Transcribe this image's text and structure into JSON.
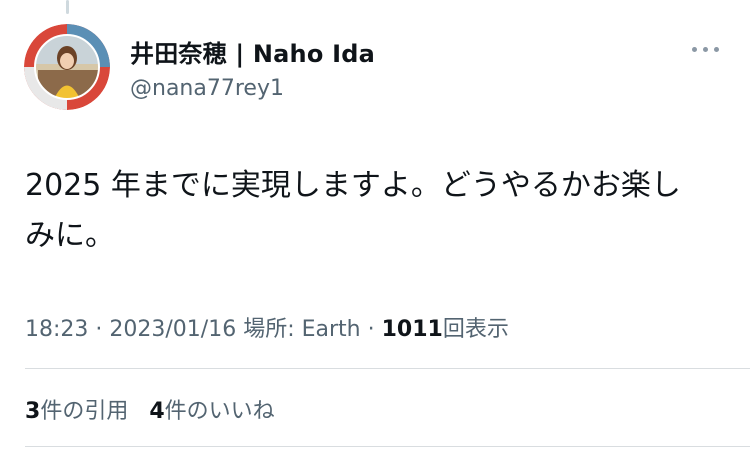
{
  "user": {
    "display_name": "井田奈穂 | Naho Ida",
    "handle": "@nana77rey1"
  },
  "tweet": {
    "text_line1": "2025 年までに実現しますよ。どうやるかお楽し",
    "text_line2": "みに。"
  },
  "meta": {
    "time": "18:23",
    "separator": " · ",
    "date": "2023/01/16",
    "location_label": "場所: Earth",
    "views_count": "1011",
    "views_label": "回表示"
  },
  "stats": {
    "quotes_count": "3",
    "quotes_label": "件の引用",
    "likes_count": "4",
    "likes_label": "件のいいね"
  },
  "icons": {
    "more": "more-horizontal-icon"
  },
  "colors": {
    "text": "#0f1419",
    "secondary": "#536471",
    "divider": "#d9dde0",
    "avatar_ring_red": "#d9473a",
    "avatar_ring_blue": "#5b8fb5"
  }
}
